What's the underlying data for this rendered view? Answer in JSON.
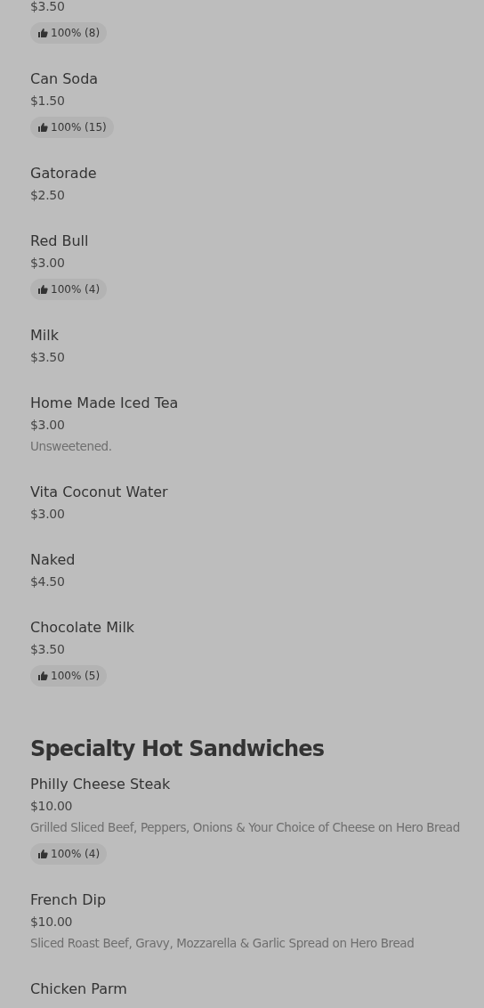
{
  "sections": [
    {
      "items": [
        {
          "price": "$3.50",
          "rating": "100% (8)"
        },
        {
          "name": "Can Soda",
          "price": "$1.50",
          "rating": "100% (15)"
        },
        {
          "name": "Gatorade",
          "price": "$2.50"
        },
        {
          "name": "Red Bull",
          "price": "$3.00",
          "rating": "100% (4)"
        },
        {
          "name": "Milk",
          "price": "$3.50"
        },
        {
          "name": "Home Made Iced Tea",
          "price": "$3.00",
          "description": "Unsweetened."
        },
        {
          "name": "Vita Coconut Water",
          "price": "$3.00"
        },
        {
          "name": "Naked",
          "price": "$4.50"
        },
        {
          "name": "Chocolate Milk",
          "price": "$3.50",
          "rating": "100% (5)"
        }
      ]
    },
    {
      "title": "Specialty Hot Sandwiches",
      "items": [
        {
          "name": "Philly Cheese Steak",
          "price": "$10.00",
          "description": "Grilled Sliced Beef, Peppers, Onions & Your Choice of Cheese on Hero Bread",
          "rating": "100% (4)"
        },
        {
          "name": "French Dip",
          "price": "$10.00",
          "description": "Sliced Roast Beef, Gravy, Mozzarella & Garlic Spread on Hero Bread"
        },
        {
          "name": "Chicken Parm"
        }
      ]
    }
  ]
}
